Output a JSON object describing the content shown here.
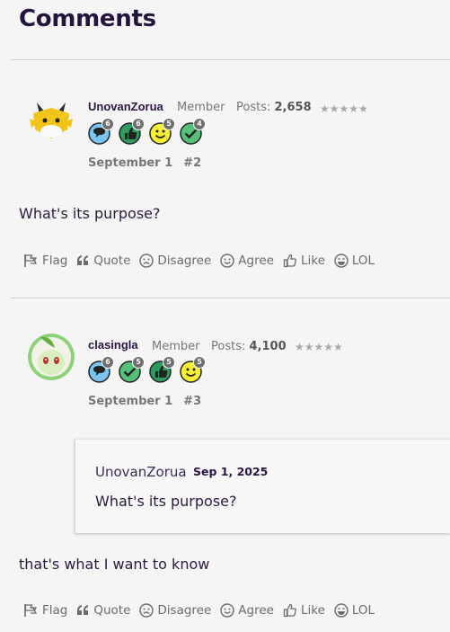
{
  "page": {
    "title": "Comments"
  },
  "comments": [
    {
      "author": "UnovanZorua",
      "role": "Member",
      "posts_label": "Posts:",
      "posts_value": "2,658",
      "stars": "★★★★★",
      "badges": [
        {
          "icon": "speech-bubble-icon",
          "count": "6",
          "color": "#7cc3f2"
        },
        {
          "icon": "thumbs-up-icon",
          "count": "6",
          "color": "#2e9a5e"
        },
        {
          "icon": "smiley-icon",
          "count": "5",
          "color": "#f5ef38"
        },
        {
          "icon": "checkmark-icon",
          "count": "4",
          "color": "#55c07a"
        }
      ],
      "date": "September 1",
      "number": "#2",
      "body": "What's its purpose?"
    },
    {
      "author": "clasingla",
      "role": "Member",
      "posts_label": "Posts:",
      "posts_value": "4,100",
      "stars": "★★★★★",
      "badges": [
        {
          "icon": "speech-bubble-icon",
          "count": "6",
          "color": "#7cc3f2"
        },
        {
          "icon": "checkmark-icon",
          "count": "5",
          "color": "#55c07a"
        },
        {
          "icon": "thumbs-up-icon",
          "count": "5",
          "color": "#2e9a5e"
        },
        {
          "icon": "smiley-icon",
          "count": "5",
          "color": "#f5ef38"
        }
      ],
      "date": "September 1",
      "number": "#3",
      "quote": {
        "author": "UnovanZorua",
        "date": "Sep 1, 2025",
        "text": "What's its purpose?"
      },
      "body": "that's what I want to know"
    }
  ],
  "actions": {
    "flag": "Flag",
    "quote": "Quote",
    "disagree": "Disagree",
    "agree": "Agree",
    "like": "Like",
    "lol": "LOL"
  }
}
